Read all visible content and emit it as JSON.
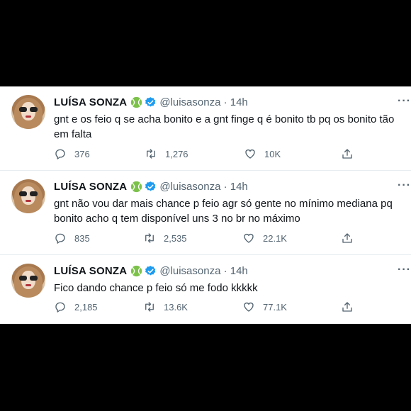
{
  "colors": {
    "text": "#0f1419",
    "secondary": "#536471",
    "verified": "#1d9bf0",
    "badge": "#5cb85c"
  },
  "tweets": [
    {
      "name": "LUÍSA SONZA",
      "handle": "@luisasonza · 14h",
      "text": "gnt e os feio q se acha bonito e a gnt finge q é bonito tb pq os bonito tão em falta",
      "replies": "376",
      "retweets": "1,276",
      "likes": "10K"
    },
    {
      "name": "LUÍSA SONZA",
      "handle": "@luisasonza · 14h",
      "text": "gnt não vou dar mais chance p feio agr só gente no mínimo mediana pq bonito acho q tem disponível uns 3 no br no máximo",
      "replies": "835",
      "retweets": "2,535",
      "likes": "22.1K"
    },
    {
      "name": "LUÍSA SONZA",
      "handle": "@luisasonza · 14h",
      "text": "Fico dando chance p feio só me fodo kkkkk",
      "replies": "2,185",
      "retweets": "13.6K",
      "likes": "77.1K"
    }
  ]
}
